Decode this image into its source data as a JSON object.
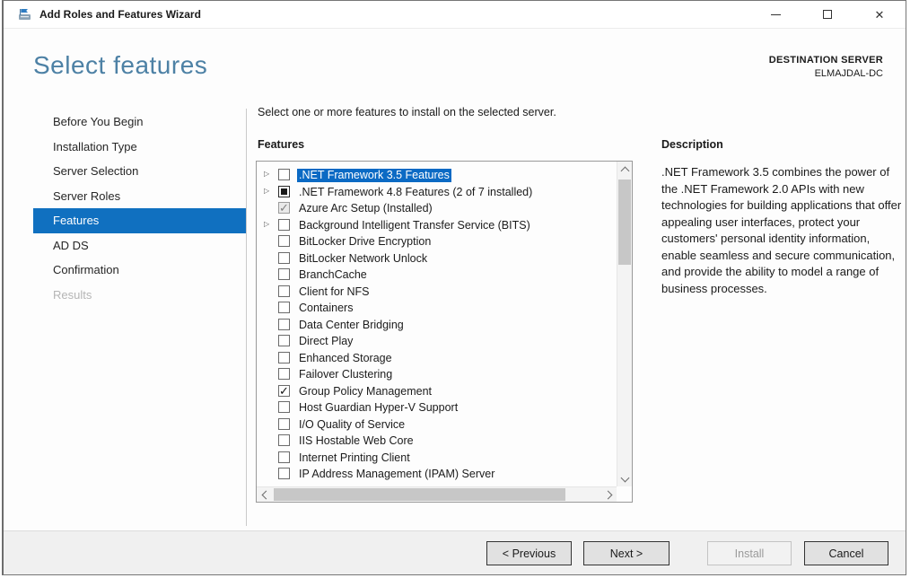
{
  "window": {
    "title": "Add Roles and Features Wizard",
    "icon": "server-manager-icon",
    "controls": [
      {
        "name": "minimize"
      },
      {
        "name": "maximize"
      },
      {
        "name": "close"
      }
    ]
  },
  "header": {
    "page_title": "Select features",
    "destination_label": "DESTINATION SERVER",
    "destination_server": "ELMAJDAL-DC"
  },
  "sidebar": {
    "items": [
      {
        "label": "Before You Begin",
        "state": "normal"
      },
      {
        "label": "Installation Type",
        "state": "normal"
      },
      {
        "label": "Server Selection",
        "state": "normal"
      },
      {
        "label": "Server Roles",
        "state": "normal"
      },
      {
        "label": "Features",
        "state": "selected"
      },
      {
        "label": "AD DS",
        "state": "normal"
      },
      {
        "label": "Confirmation",
        "state": "normal"
      },
      {
        "label": "Results",
        "state": "disabled"
      }
    ]
  },
  "main": {
    "instruction": "Select one or more features to install on the selected server.",
    "features_label": "Features",
    "features": [
      {
        "label": ".NET Framework 3.5 Features",
        "checkbox": "unchecked",
        "expander": true,
        "highlighted": true
      },
      {
        "label": ".NET Framework 4.8 Features (2 of 7 installed)",
        "checkbox": "indeterminate",
        "expander": true,
        "highlighted": false
      },
      {
        "label": "Azure Arc Setup (Installed)",
        "checkbox": "checked-disabled",
        "expander": false,
        "highlighted": false
      },
      {
        "label": "Background Intelligent Transfer Service (BITS)",
        "checkbox": "unchecked",
        "expander": true,
        "highlighted": false
      },
      {
        "label": "BitLocker Drive Encryption",
        "checkbox": "unchecked",
        "expander": false,
        "highlighted": false
      },
      {
        "label": "BitLocker Network Unlock",
        "checkbox": "unchecked",
        "expander": false,
        "highlighted": false
      },
      {
        "label": "BranchCache",
        "checkbox": "unchecked",
        "expander": false,
        "highlighted": false
      },
      {
        "label": "Client for NFS",
        "checkbox": "unchecked",
        "expander": false,
        "highlighted": false
      },
      {
        "label": "Containers",
        "checkbox": "unchecked",
        "expander": false,
        "highlighted": false
      },
      {
        "label": "Data Center Bridging",
        "checkbox": "unchecked",
        "expander": false,
        "highlighted": false
      },
      {
        "label": "Direct Play",
        "checkbox": "unchecked",
        "expander": false,
        "highlighted": false
      },
      {
        "label": "Enhanced Storage",
        "checkbox": "unchecked",
        "expander": false,
        "highlighted": false
      },
      {
        "label": "Failover Clustering",
        "checkbox": "unchecked",
        "expander": false,
        "highlighted": false
      },
      {
        "label": "Group Policy Management",
        "checkbox": "checked",
        "expander": false,
        "highlighted": false
      },
      {
        "label": "Host Guardian Hyper-V Support",
        "checkbox": "unchecked",
        "expander": false,
        "highlighted": false
      },
      {
        "label": "I/O Quality of Service",
        "checkbox": "unchecked",
        "expander": false,
        "highlighted": false
      },
      {
        "label": "IIS Hostable Web Core",
        "checkbox": "unchecked",
        "expander": false,
        "highlighted": false
      },
      {
        "label": "Internet Printing Client",
        "checkbox": "unchecked",
        "expander": false,
        "highlighted": false
      },
      {
        "label": "IP Address Management (IPAM) Server",
        "checkbox": "unchecked",
        "expander": false,
        "highlighted": false
      }
    ]
  },
  "description": {
    "title": "Description",
    "body": ".NET Framework 3.5 combines the power of the .NET Framework 2.0 APIs with new technologies for building applications that offer appealing user interfaces, protect your customers' personal identity information, enable seamless and secure communication, and provide the ability to model a range of business processes."
  },
  "footer": {
    "buttons": [
      {
        "label": "< Previous",
        "enabled": true
      },
      {
        "label": "Next >",
        "enabled": true
      },
      {
        "label": "Install",
        "enabled": false
      },
      {
        "label": "Cancel",
        "enabled": true
      }
    ]
  },
  "icons": {
    "expander": "▷",
    "close": "✕",
    "checkmark": "✓"
  },
  "colors": {
    "accent_selected": "#1070c0",
    "list_highlight": "#0b6ac4",
    "heading_blue": "#4d81a5",
    "footer_bg": "#f0f0f0"
  }
}
